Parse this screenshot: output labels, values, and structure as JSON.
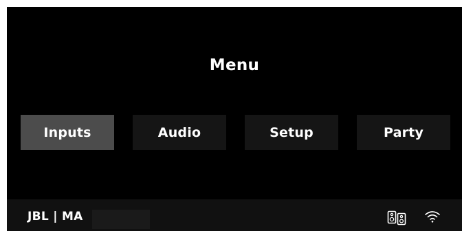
{
  "title": "Menu",
  "menu": {
    "items": [
      {
        "label": "Inputs",
        "selected": true
      },
      {
        "label": "Audio",
        "selected": false
      },
      {
        "label": "Setup",
        "selected": false
      },
      {
        "label": "Party",
        "selected": false
      }
    ]
  },
  "status": {
    "device_name": "JBL | MA",
    "icons": [
      "speakers-icon",
      "wifi-icon"
    ]
  },
  "colors": {
    "background": "#000000",
    "selected_button": "#4c4c4c",
    "button": "#151515",
    "status_bar": "#111111",
    "text": "#ffffff"
  }
}
